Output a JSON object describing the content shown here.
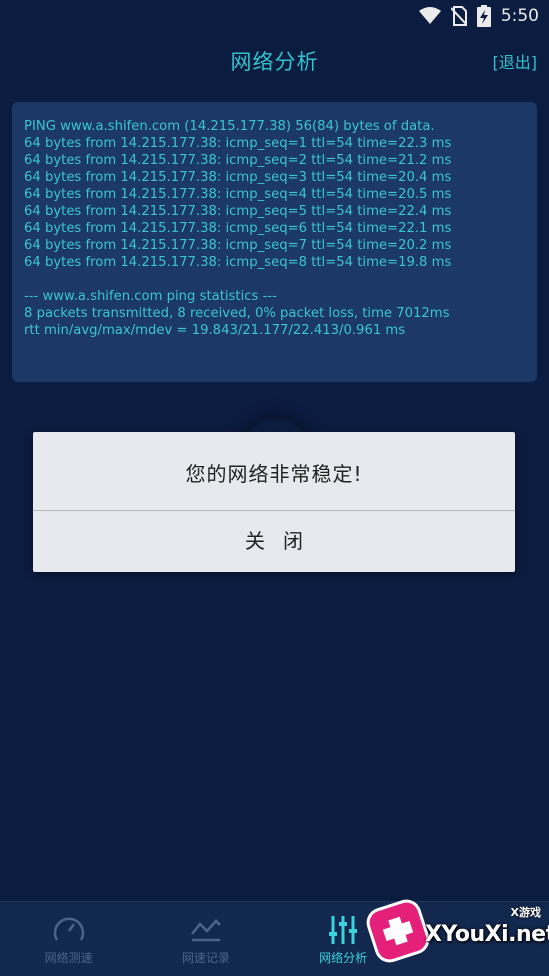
{
  "status_bar": {
    "time": "5:50",
    "icons": [
      "wifi-icon",
      "no-sim-icon",
      "battery-charging-icon"
    ]
  },
  "header": {
    "title": "网络分析",
    "exit_label": "[退出]"
  },
  "console": {
    "output": "PING www.a.shifen.com (14.215.177.38) 56(84) bytes of data.\n64 bytes from 14.215.177.38: icmp_seq=1 ttl=54 time=22.3 ms\n64 bytes from 14.215.177.38: icmp_seq=2 ttl=54 time=21.2 ms\n64 bytes from 14.215.177.38: icmp_seq=3 ttl=54 time=20.4 ms\n64 bytes from 14.215.177.38: icmp_seq=4 ttl=54 time=20.5 ms\n64 bytes from 14.215.177.38: icmp_seq=5 ttl=54 time=22.4 ms\n64 bytes from 14.215.177.38: icmp_seq=6 ttl=54 time=22.1 ms\n64 bytes from 14.215.177.38: icmp_seq=7 ttl=54 time=20.2 ms\n64 bytes from 14.215.177.38: icmp_seq=8 ttl=54 time=19.8 ms\n\n--- www.a.shifen.com ping statistics ---\n8 packets transmitted, 8 received, 0% packet loss, time 7012ms\nrtt min/avg/max/mdev = 19.843/21.177/22.413/0.961 ms"
  },
  "dialog": {
    "message": "您的网络非常稳定!",
    "close_label": "关闭"
  },
  "bottom_nav": {
    "tabs": [
      {
        "label": "网络测速",
        "icon": "speedometer-icon",
        "active": false
      },
      {
        "label": "网速记录",
        "icon": "line-chart-icon",
        "active": false
      },
      {
        "label": "网络分析",
        "icon": "sliders-icon",
        "active": true
      },
      {
        "label": "",
        "icon": "settings-icon",
        "active": false
      }
    ]
  },
  "watermark": {
    "text": "XYouXi.net",
    "badge": "X游戏"
  },
  "colors": {
    "background": "#0d1f47",
    "accent": "#38d3dd",
    "console_bg": "#1f3d6e",
    "dialog_bg": "#e8e9ee"
  }
}
